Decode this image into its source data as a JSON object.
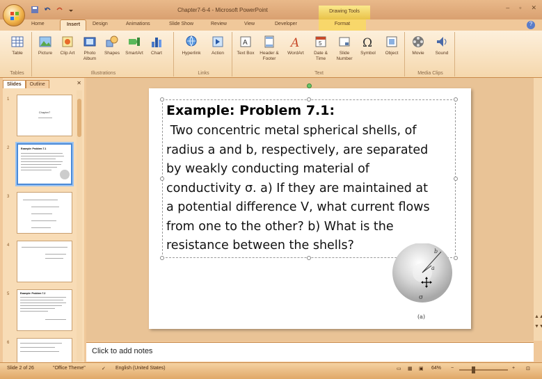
{
  "window": {
    "title": "Chapter7-6-4 - Microsoft PowerPoint",
    "contextual_tab_group": "Drawing Tools"
  },
  "tabs": [
    "Home",
    "Insert",
    "Design",
    "Animations",
    "Slide Show",
    "Review",
    "View",
    "Developer",
    "Format"
  ],
  "active_tab": "Insert",
  "ribbon": {
    "groups": [
      {
        "name": "Tables",
        "buttons": [
          {
            "label": "Table",
            "icon": "table-icon"
          }
        ]
      },
      {
        "name": "Illustrations",
        "buttons": [
          {
            "label": "Picture",
            "icon": "picture-icon"
          },
          {
            "label": "Clip Art",
            "icon": "clip-art-icon"
          },
          {
            "label": "Photo Album",
            "icon": "photo-album-icon"
          },
          {
            "label": "Shapes",
            "icon": "shapes-icon"
          },
          {
            "label": "SmartArt",
            "icon": "smartart-icon"
          },
          {
            "label": "Chart",
            "icon": "chart-icon"
          }
        ]
      },
      {
        "name": "Links",
        "buttons": [
          {
            "label": "Hyperlink",
            "icon": "hyperlink-icon"
          },
          {
            "label": "Action",
            "icon": "action-icon"
          }
        ]
      },
      {
        "name": "Text",
        "buttons": [
          {
            "label": "Text Box",
            "icon": "text-box-icon"
          },
          {
            "label": "Header & Footer",
            "icon": "header-footer-icon"
          },
          {
            "label": "WordArt",
            "icon": "wordart-icon"
          },
          {
            "label": "Date & Time",
            "icon": "date-time-icon"
          },
          {
            "label": "Slide Number",
            "icon": "slide-number-icon"
          },
          {
            "label": "Symbol",
            "icon": "symbol-icon"
          },
          {
            "label": "Object",
            "icon": "object-icon"
          }
        ]
      },
      {
        "name": "Media Clips",
        "buttons": [
          {
            "label": "Movie",
            "icon": "movie-icon"
          },
          {
            "label": "Sound",
            "icon": "sound-icon"
          }
        ]
      }
    ]
  },
  "left_pane": {
    "tabs": [
      "Slides",
      "Outline"
    ],
    "active_tab": "Slides",
    "thumbnails": [
      {
        "number": "1",
        "text": "Chapter7"
      },
      {
        "number": "2",
        "text": "Example: Problem 7.1"
      },
      {
        "number": "3",
        "text": ""
      },
      {
        "number": "4",
        "text": ""
      },
      {
        "number": "5",
        "text": "Example: Problem 7.2"
      },
      {
        "number": "6",
        "text": ""
      }
    ],
    "selected_index": 1
  },
  "slide": {
    "title": "Example: Problem 7.1:",
    "body_lines": [
      " Two concentric metal spherical shells, of",
      "radius a and b, respectively, are separated",
      "by weakly conducting material of",
      "conductivity σ. a) If they are maintained at",
      "a potential difference V, what current flows",
      "from one to the other? b) What is the",
      "resistance between the shells?"
    ],
    "figure": {
      "labels": {
        "outer": "b",
        "inner": "a",
        "material": "σ",
        "caption": "(a)"
      }
    }
  },
  "notes": {
    "placeholder": "Click to add notes"
  },
  "status_bar": {
    "slide_indicator": "Slide 2 of 26",
    "theme": "\"Office Theme\"",
    "language": "English (United States)",
    "zoom": "64%"
  },
  "colors": {
    "frame": "#f0c89a",
    "selection": "#4a8ad8",
    "format_tab": "#f8d76a"
  }
}
